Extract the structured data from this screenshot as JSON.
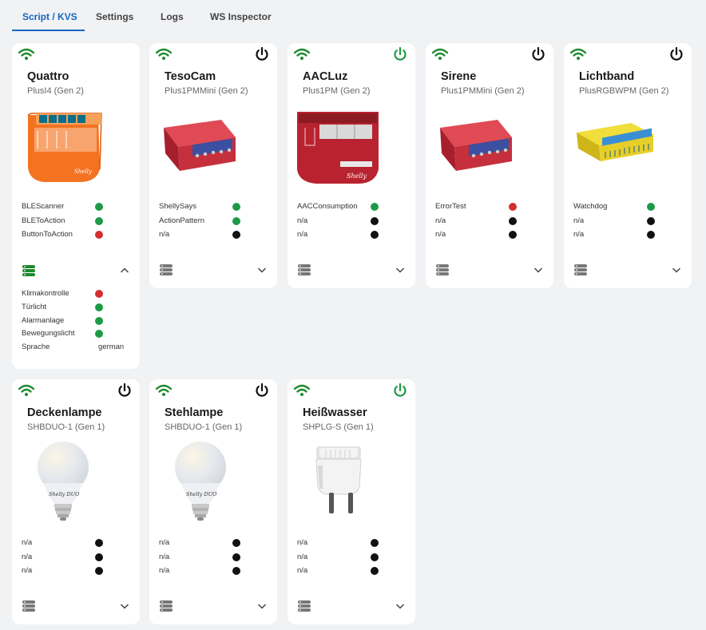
{
  "tabs": [
    {
      "label": "Script / KVS"
    },
    {
      "label": "Settings"
    },
    {
      "label": "Logs"
    },
    {
      "label": "WS Inspector"
    }
  ],
  "colors": {
    "accent": "#1565c0",
    "online": "#1e9a47",
    "error": "#d32f2f",
    "inactive": "#111111",
    "power_on": "#1e9a47"
  },
  "cards": [
    {
      "name": "Quattro",
      "model": "PlusI4 (Gen 2)",
      "icon": "plus-i4-device",
      "rows": [
        {
          "label": "BLEScanner"
        },
        {
          "label": "BLEToAction"
        },
        {
          "label": "ButtonToAction"
        }
      ],
      "kvs": [
        {
          "label": "Klimakontrolle"
        },
        {
          "label": "Türlicht"
        },
        {
          "label": "Alarmanlage"
        },
        {
          "label": "Bewegungslicht"
        },
        {
          "label": "Sprache",
          "value": "german"
        }
      ]
    },
    {
      "name": "TesoCam",
      "model": "Plus1PMMini (Gen 2)",
      "power": "off",
      "rows": [
        {
          "label": "ShellySays"
        },
        {
          "label": "ActionPattern"
        },
        {
          "label": "n/a"
        }
      ]
    },
    {
      "name": "AACLuz",
      "model": "Plus1PM (Gen 2)",
      "power": "on",
      "rows": [
        {
          "label": "AACConsumption"
        },
        {
          "label": "n/a"
        },
        {
          "label": "n/a"
        }
      ]
    },
    {
      "name": "Sirene",
      "model": "Plus1PMMini (Gen 2)",
      "power": "off",
      "rows": [
        {
          "label": "ErrorTest"
        },
        {
          "label": "n/a"
        },
        {
          "label": "n/a"
        }
      ]
    },
    {
      "name": "Lichtband",
      "model": "PlusRGBWPM (Gen 2)",
      "power": "off",
      "rows": [
        {
          "label": "Watchdog"
        },
        {
          "label": "n/a"
        },
        {
          "label": "n/a"
        }
      ]
    },
    {
      "name": "Deckenlampe",
      "model": "SHBDUO-1 (Gen 1)",
      "power": "off",
      "rows": [
        {
          "label": "n/a"
        },
        {
          "label": "n/a"
        },
        {
          "label": "n/a"
        }
      ]
    },
    {
      "name": "Stehlampe",
      "model": "SHBDUO-1 (Gen 1)",
      "power": "off",
      "rows": [
        {
          "label": "n/a"
        },
        {
          "label": "n/a"
        },
        {
          "label": "n/a"
        }
      ]
    },
    {
      "name": "Heißwasser",
      "model": "SHPLG-S (Gen 1)",
      "power": "on",
      "rows": [
        {
          "label": "n/a"
        },
        {
          "label": "n/a"
        },
        {
          "label": "n/a"
        }
      ]
    }
  ]
}
